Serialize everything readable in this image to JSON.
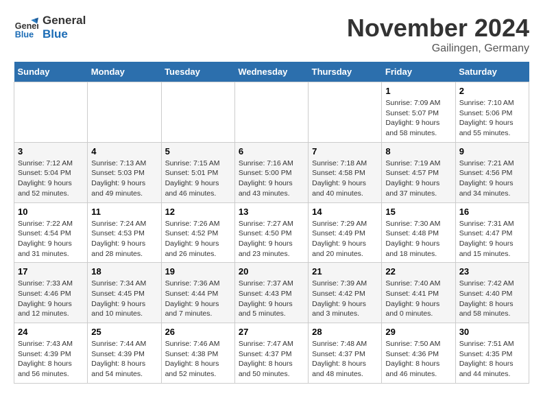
{
  "header": {
    "logo_line1": "General",
    "logo_line2": "Blue",
    "month_title": "November 2024",
    "location": "Gailingen, Germany"
  },
  "weekdays": [
    "Sunday",
    "Monday",
    "Tuesday",
    "Wednesday",
    "Thursday",
    "Friday",
    "Saturday"
  ],
  "weeks": [
    [
      {
        "day": "",
        "info": ""
      },
      {
        "day": "",
        "info": ""
      },
      {
        "day": "",
        "info": ""
      },
      {
        "day": "",
        "info": ""
      },
      {
        "day": "",
        "info": ""
      },
      {
        "day": "1",
        "info": "Sunrise: 7:09 AM\nSunset: 5:07 PM\nDaylight: 9 hours and 58 minutes."
      },
      {
        "day": "2",
        "info": "Sunrise: 7:10 AM\nSunset: 5:06 PM\nDaylight: 9 hours and 55 minutes."
      }
    ],
    [
      {
        "day": "3",
        "info": "Sunrise: 7:12 AM\nSunset: 5:04 PM\nDaylight: 9 hours and 52 minutes."
      },
      {
        "day": "4",
        "info": "Sunrise: 7:13 AM\nSunset: 5:03 PM\nDaylight: 9 hours and 49 minutes."
      },
      {
        "day": "5",
        "info": "Sunrise: 7:15 AM\nSunset: 5:01 PM\nDaylight: 9 hours and 46 minutes."
      },
      {
        "day": "6",
        "info": "Sunrise: 7:16 AM\nSunset: 5:00 PM\nDaylight: 9 hours and 43 minutes."
      },
      {
        "day": "7",
        "info": "Sunrise: 7:18 AM\nSunset: 4:58 PM\nDaylight: 9 hours and 40 minutes."
      },
      {
        "day": "8",
        "info": "Sunrise: 7:19 AM\nSunset: 4:57 PM\nDaylight: 9 hours and 37 minutes."
      },
      {
        "day": "9",
        "info": "Sunrise: 7:21 AM\nSunset: 4:56 PM\nDaylight: 9 hours and 34 minutes."
      }
    ],
    [
      {
        "day": "10",
        "info": "Sunrise: 7:22 AM\nSunset: 4:54 PM\nDaylight: 9 hours and 31 minutes."
      },
      {
        "day": "11",
        "info": "Sunrise: 7:24 AM\nSunset: 4:53 PM\nDaylight: 9 hours and 28 minutes."
      },
      {
        "day": "12",
        "info": "Sunrise: 7:26 AM\nSunset: 4:52 PM\nDaylight: 9 hours and 26 minutes."
      },
      {
        "day": "13",
        "info": "Sunrise: 7:27 AM\nSunset: 4:50 PM\nDaylight: 9 hours and 23 minutes."
      },
      {
        "day": "14",
        "info": "Sunrise: 7:29 AM\nSunset: 4:49 PM\nDaylight: 9 hours and 20 minutes."
      },
      {
        "day": "15",
        "info": "Sunrise: 7:30 AM\nSunset: 4:48 PM\nDaylight: 9 hours and 18 minutes."
      },
      {
        "day": "16",
        "info": "Sunrise: 7:31 AM\nSunset: 4:47 PM\nDaylight: 9 hours and 15 minutes."
      }
    ],
    [
      {
        "day": "17",
        "info": "Sunrise: 7:33 AM\nSunset: 4:46 PM\nDaylight: 9 hours and 12 minutes."
      },
      {
        "day": "18",
        "info": "Sunrise: 7:34 AM\nSunset: 4:45 PM\nDaylight: 9 hours and 10 minutes."
      },
      {
        "day": "19",
        "info": "Sunrise: 7:36 AM\nSunset: 4:44 PM\nDaylight: 9 hours and 7 minutes."
      },
      {
        "day": "20",
        "info": "Sunrise: 7:37 AM\nSunset: 4:43 PM\nDaylight: 9 hours and 5 minutes."
      },
      {
        "day": "21",
        "info": "Sunrise: 7:39 AM\nSunset: 4:42 PM\nDaylight: 9 hours and 3 minutes."
      },
      {
        "day": "22",
        "info": "Sunrise: 7:40 AM\nSunset: 4:41 PM\nDaylight: 9 hours and 0 minutes."
      },
      {
        "day": "23",
        "info": "Sunrise: 7:42 AM\nSunset: 4:40 PM\nDaylight: 8 hours and 58 minutes."
      }
    ],
    [
      {
        "day": "24",
        "info": "Sunrise: 7:43 AM\nSunset: 4:39 PM\nDaylight: 8 hours and 56 minutes."
      },
      {
        "day": "25",
        "info": "Sunrise: 7:44 AM\nSunset: 4:39 PM\nDaylight: 8 hours and 54 minutes."
      },
      {
        "day": "26",
        "info": "Sunrise: 7:46 AM\nSunset: 4:38 PM\nDaylight: 8 hours and 52 minutes."
      },
      {
        "day": "27",
        "info": "Sunrise: 7:47 AM\nSunset: 4:37 PM\nDaylight: 8 hours and 50 minutes."
      },
      {
        "day": "28",
        "info": "Sunrise: 7:48 AM\nSunset: 4:37 PM\nDaylight: 8 hours and 48 minutes."
      },
      {
        "day": "29",
        "info": "Sunrise: 7:50 AM\nSunset: 4:36 PM\nDaylight: 8 hours and 46 minutes."
      },
      {
        "day": "30",
        "info": "Sunrise: 7:51 AM\nSunset: 4:35 PM\nDaylight: 8 hours and 44 minutes."
      }
    ]
  ]
}
